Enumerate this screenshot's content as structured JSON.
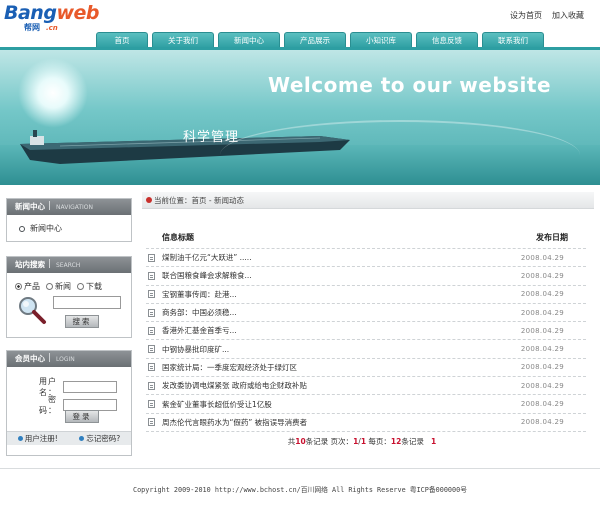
{
  "logo": {
    "main_a": "Bang",
    "main_b": "web",
    "sub": "帮网",
    "sub_cn": ".cn"
  },
  "toplinks": [
    "设为首页",
    "加入收藏"
  ],
  "nav": [
    "首页",
    "关于我们",
    "新闻中心",
    "产品展示",
    "小知识库",
    "信息反馈",
    "联系我们"
  ],
  "banner": {
    "welcome": "Welcome to our website",
    "cn_text": "科学管理"
  },
  "sidebar": {
    "news": {
      "title": "新闻中心",
      "en": "NAVIGATION",
      "item": "新闻中心"
    },
    "search": {
      "title": "站内搜索",
      "en": "SEARCH",
      "options": [
        "产品",
        "新闻",
        "下载"
      ],
      "selected_index": 0,
      "button": "搜索"
    },
    "login": {
      "title": "会员中心",
      "en": "LOGIN",
      "username_label": "用户名：",
      "password_label": "密　码：",
      "button": "登录",
      "register": "用户注册!",
      "forgot": "忘记密码?"
    }
  },
  "main": {
    "breadcrumb": "当前位置：首页 - 新闻动态",
    "col_title": "信息标题",
    "col_date": "发布日期",
    "rows": [
      {
        "title": "煤制油千亿元“大跃进” .....",
        "date": "2008.04.29"
      },
      {
        "title": "联合国粮食峰会求解粮食...",
        "date": "2008.04.29"
      },
      {
        "title": "宝钢董事传闻：赴港...",
        "date": "2008.04.29"
      },
      {
        "title": "商务部：中国必须稳...",
        "date": "2008.04.29"
      },
      {
        "title": "香港外汇基金首季亏...",
        "date": "2008.04.29"
      },
      {
        "title": "中钢协暴批印度矿...",
        "date": "2008.04.29"
      },
      {
        "title": "国家统计局：一季度宏观经济处于绿灯区",
        "date": "2008.04.29"
      },
      {
        "title": "发改委协调电煤紧张 政府或给电企财政补贴",
        "date": "2008.04.29"
      },
      {
        "title": "紫金矿业董事长超低价受让1亿股",
        "date": "2008.04.29"
      },
      {
        "title": "周杰伦代言眼药水为“假药” 被指误导消费者",
        "date": "2008.04.29"
      }
    ],
    "pager": {
      "prefix": "共",
      "total": "10",
      "mid1": "条记录 页次：",
      "page": "1",
      "sep": "/",
      "pages": "1",
      "mid2": " 每页：",
      "per": "12",
      "mid3": "条记录 ",
      "link": "1"
    }
  },
  "footer": "Copyright 2009-2010 http://www.bchost.cn/百川网络 All Rights Reserve 粤ICP备000000号"
}
